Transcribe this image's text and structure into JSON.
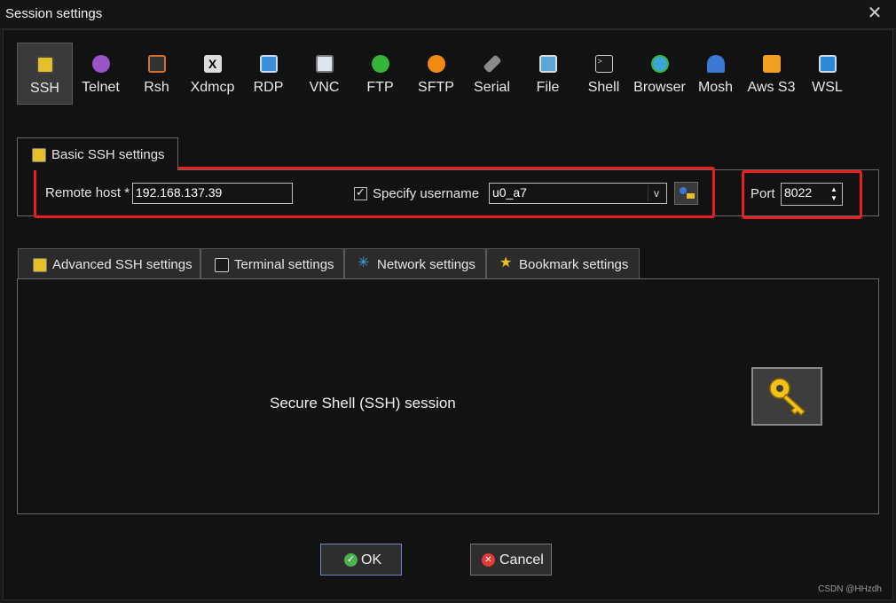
{
  "window": {
    "title": "Session settings"
  },
  "toolbar": {
    "items": [
      {
        "label": "SSH",
        "icon": "ssh-key-icon",
        "color": "#e3c02a",
        "active": true
      },
      {
        "label": "Telnet",
        "icon": "telnet-icon",
        "color": "#9a54c8"
      },
      {
        "label": "Rsh",
        "icon": "rsh-icon",
        "color": "#d8702a"
      },
      {
        "label": "Xdmcp",
        "icon": "xdmcp-icon",
        "color": "#dddddd"
      },
      {
        "label": "RDP",
        "icon": "rdp-icon",
        "color": "#3a8fd8"
      },
      {
        "label": "VNC",
        "icon": "vnc-icon",
        "color": "#dde6ee"
      },
      {
        "label": "FTP",
        "icon": "ftp-icon",
        "color": "#36b33a"
      },
      {
        "label": "SFTP",
        "icon": "sftp-icon",
        "color": "#f08a12"
      },
      {
        "label": "Serial",
        "icon": "serial-icon",
        "color": "#8a8a8a"
      },
      {
        "label": "File",
        "icon": "file-icon",
        "color": "#5aa6d6"
      },
      {
        "label": "Shell",
        "icon": "shell-icon",
        "color": "#2a2a2a"
      },
      {
        "label": "Browser",
        "icon": "browser-icon",
        "color": "#3aa7d8"
      },
      {
        "label": "Mosh",
        "icon": "mosh-icon",
        "color": "#3a78d8"
      },
      {
        "label": "Aws S3",
        "icon": "aws-s3-icon",
        "color": "#f0a020"
      },
      {
        "label": "WSL",
        "icon": "wsl-icon",
        "color": "#2a8ad8"
      }
    ]
  },
  "basic": {
    "tab_label": "Basic SSH settings",
    "remote_host_label": "Remote host *",
    "remote_host_value": "192.168.137.39",
    "specify_username_label": "Specify username",
    "specify_username_checked": true,
    "username_value": "u0_a7",
    "port_label": "Port",
    "port_value": "8022"
  },
  "subtabs": [
    {
      "label": "Advanced SSH settings",
      "icon": "wrench-icon",
      "color": "#e3c02a"
    },
    {
      "label": "Terminal settings",
      "icon": "terminal-icon",
      "color": "#5aa6d6"
    },
    {
      "label": "Network settings",
      "icon": "network-icon",
      "color": "#3aa7d8"
    },
    {
      "label": "Bookmark settings",
      "icon": "star-icon",
      "color": "#f0c020"
    }
  ],
  "content": {
    "description": "Secure Shell (SSH) session"
  },
  "buttons": {
    "ok_label": "OK",
    "cancel_label": "Cancel"
  },
  "watermark": "CSDN @HHzdh",
  "colors": {
    "highlight": "#e8201b",
    "accent_ok": "#4caf50",
    "accent_cancel": "#e53935"
  }
}
